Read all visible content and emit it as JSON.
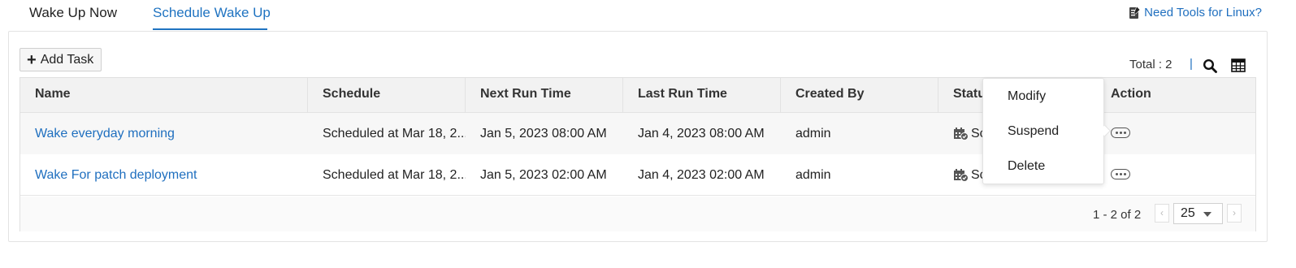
{
  "tabs": [
    {
      "label": "Wake Up Now"
    },
    {
      "label": "Schedule Wake Up"
    }
  ],
  "tools_link": {
    "label": "Need Tools for Linux?",
    "icon": "edit-note-icon"
  },
  "toolbar": {
    "add_task_label": "Add Task",
    "total_label": "Total : 2",
    "separator": "|",
    "search_icon": "search-icon",
    "columns_icon": "table-columns-icon"
  },
  "table": {
    "columns": [
      "Name",
      "Schedule",
      "Next Run Time",
      "Last Run Time",
      "Created By",
      "Status",
      "Action"
    ],
    "rows": [
      {
        "name": "Wake everyday morning",
        "schedule": "Scheduled at Mar 18, 2...",
        "next_run": "Jan 5, 2023 08:00 AM",
        "last_run": "Jan 4, 2023 08:00 AM",
        "created_by": "admin",
        "status": "Sc"
      },
      {
        "name": "Wake For patch deployment",
        "schedule": "Scheduled at Mar 18, 2...",
        "next_run": "Jan 5, 2023 02:00 AM",
        "last_run": "Jan 4, 2023 02:00 AM",
        "created_by": "admin",
        "status": "Sc"
      }
    ]
  },
  "pagination": {
    "range_label": "1 - 2 of 2",
    "page_size": "25",
    "prev": "‹",
    "next": "›"
  },
  "context_menu": {
    "items": [
      "Modify",
      "Suspend",
      "Delete"
    ]
  },
  "colors": {
    "accent": "#1f73c1",
    "link": "#1f6fbf",
    "header_bg": "#f2f2f2"
  }
}
